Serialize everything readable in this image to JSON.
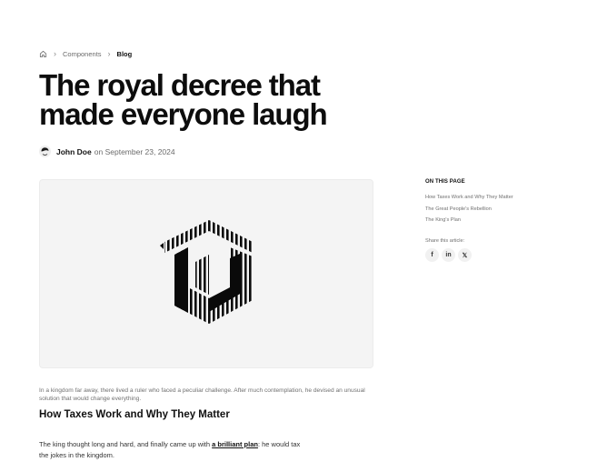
{
  "breadcrumb": {
    "home_icon": "home-icon",
    "items": [
      "Components",
      "Blog"
    ]
  },
  "article": {
    "title": "The royal decree that made everyone laugh",
    "author": "John Doe",
    "date_prefix": "on",
    "date": "September 23, 2024",
    "caption": "In a kingdom far away, there lived a ruler who faced a peculiar challenge. After much contemplation, he devised an unusual solution that would change everything.",
    "section_heading": "How Taxes Work and Why They Matter",
    "paragraph_before": "The king thought long and hard, and finally came up with ",
    "paragraph_link": "a brilliant plan",
    "paragraph_after": ": he would tax the jokes in the kingdom."
  },
  "toc": {
    "heading": "ON THIS PAGE",
    "items": [
      "How Taxes Work and Why They Matter",
      "The Great People's Rebellion",
      "The King's Plan"
    ]
  },
  "share": {
    "label": "Share this article:",
    "buttons": [
      {
        "icon": "facebook-icon",
        "glyph": "f"
      },
      {
        "icon": "linkedin-icon",
        "glyph": "in"
      },
      {
        "icon": "twitter-icon",
        "glyph": "𝕏"
      }
    ]
  },
  "colors": {
    "text": "#111111",
    "muted": "#6b6b6b",
    "hero_bg": "#f4f4f4"
  }
}
